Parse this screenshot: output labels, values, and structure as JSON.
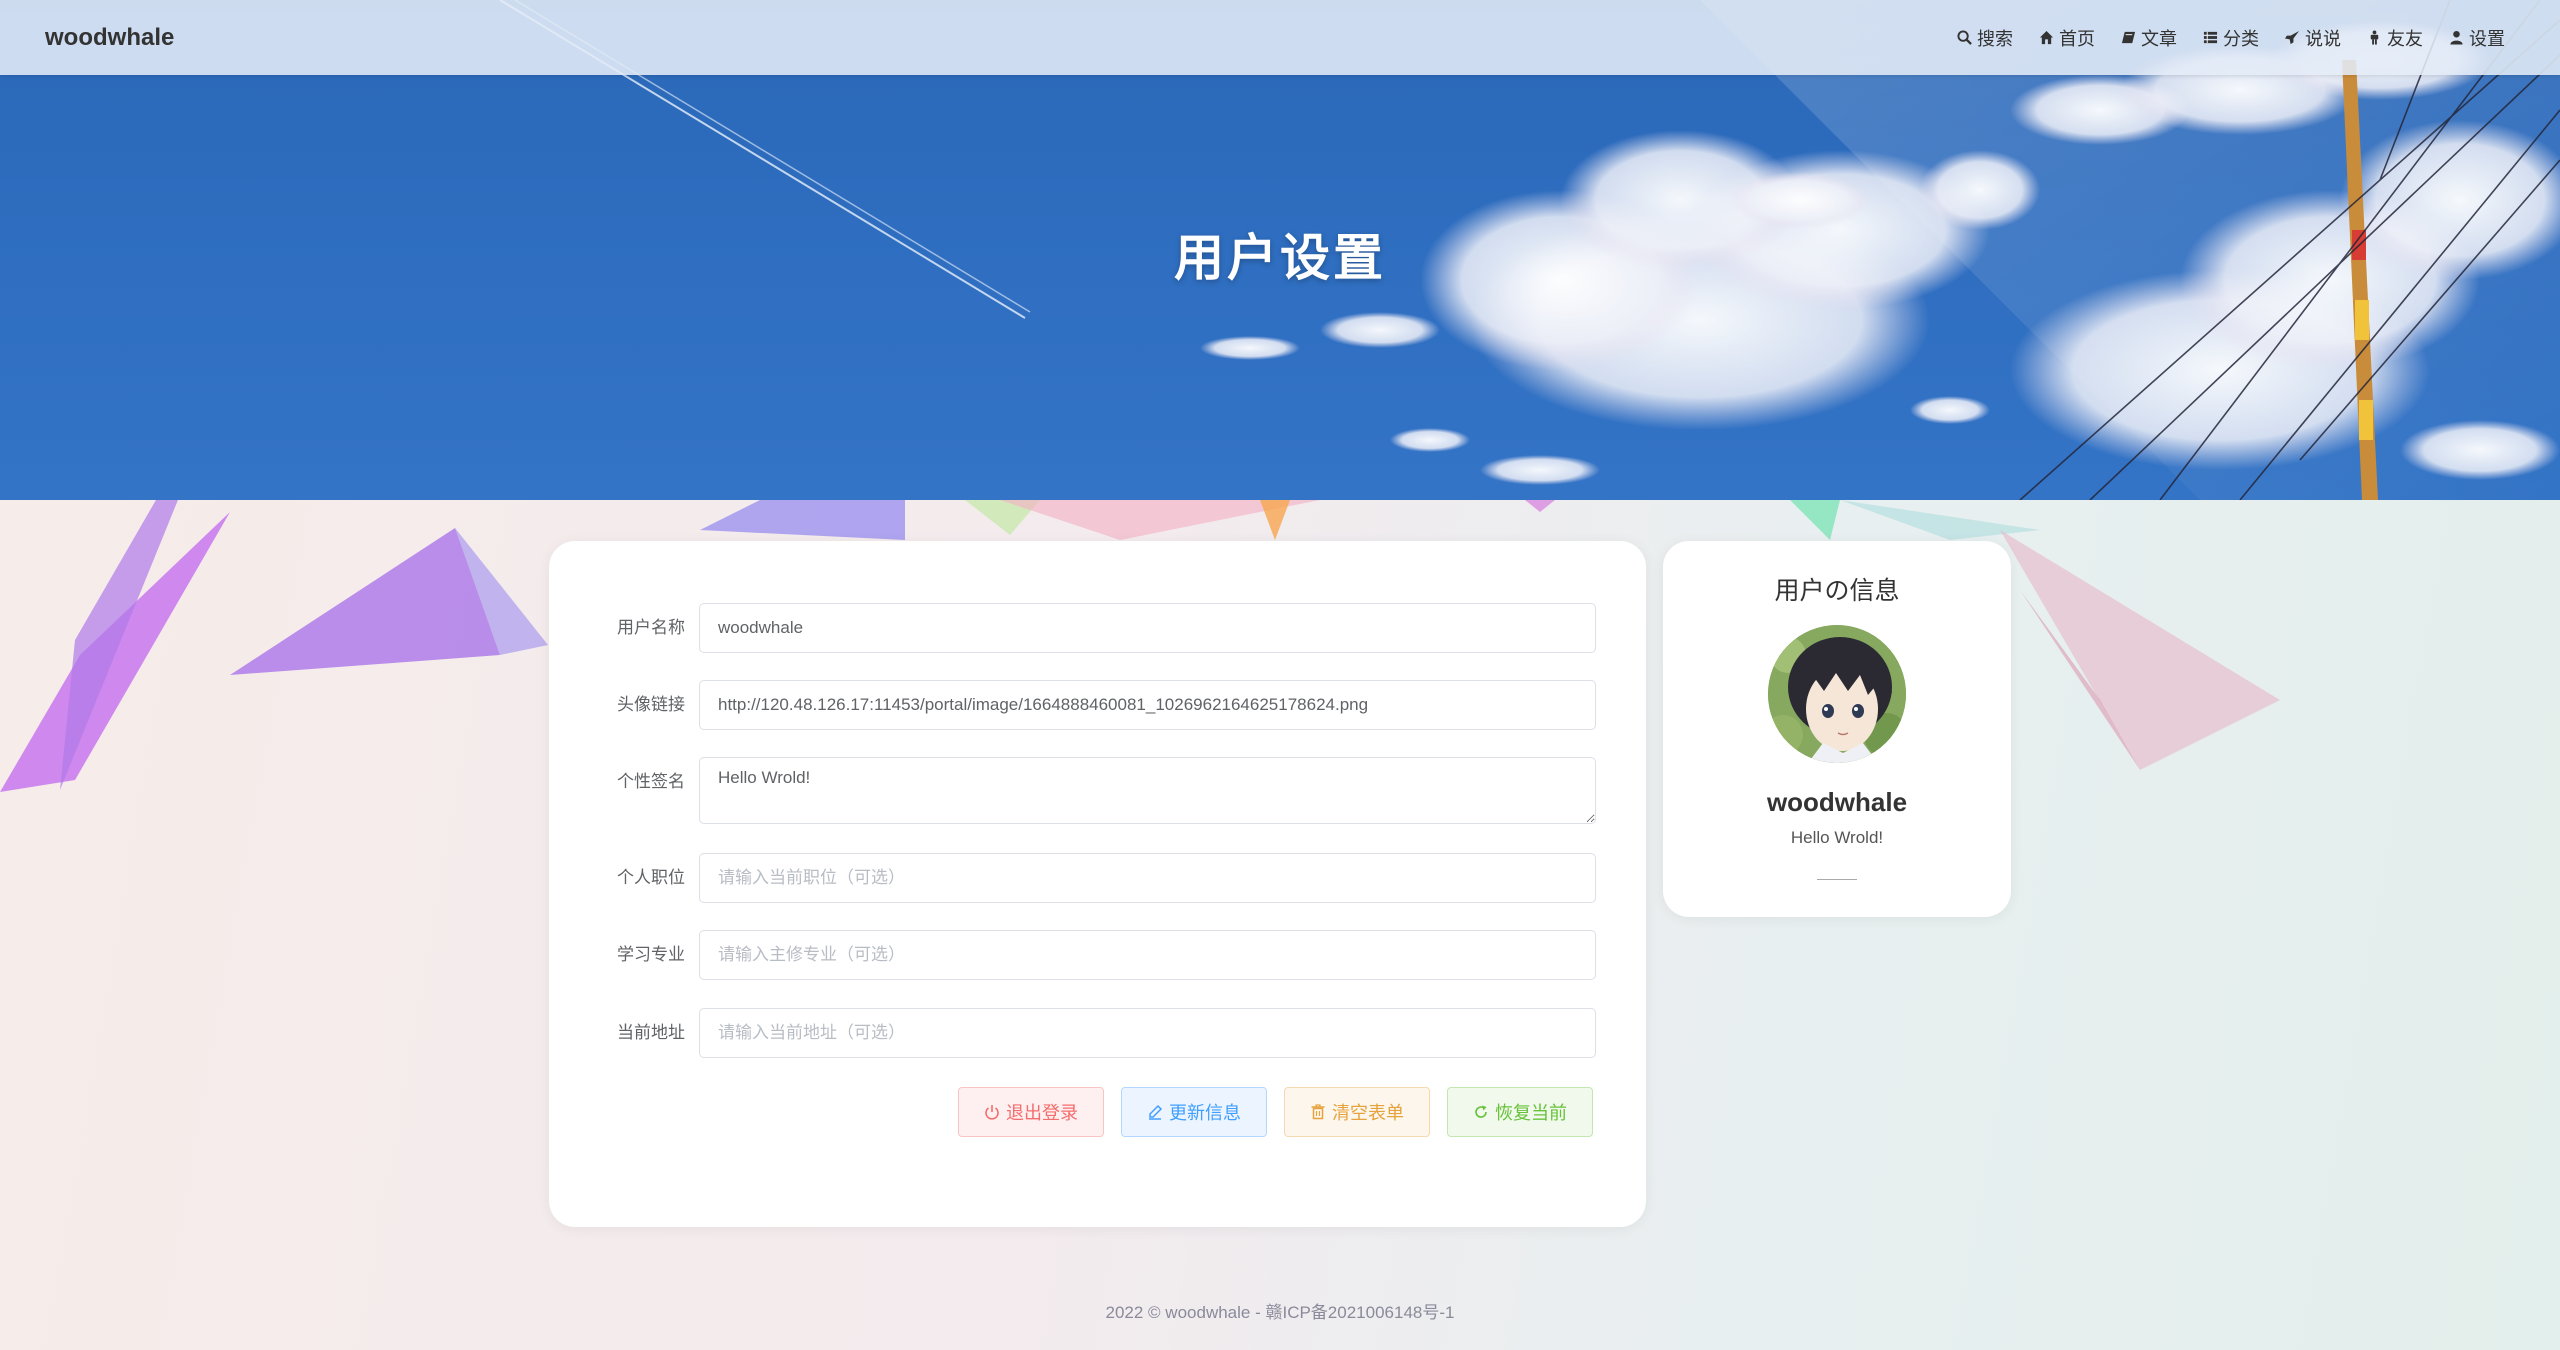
{
  "navbar": {
    "brand": "woodwhale",
    "items": [
      {
        "label": "搜索",
        "icon": "search-icon"
      },
      {
        "label": "首页",
        "icon": "home-icon"
      },
      {
        "label": "文章",
        "icon": "book-icon"
      },
      {
        "label": "分类",
        "icon": "list-icon"
      },
      {
        "label": "说说",
        "icon": "rocket-icon"
      },
      {
        "label": "友友",
        "icon": "person-icon"
      },
      {
        "label": "设置",
        "icon": "user-icon"
      }
    ]
  },
  "hero": {
    "title": "用户设置"
  },
  "form": {
    "username": {
      "label": "用户名称",
      "value": "woodwhale"
    },
    "avatar_url": {
      "label": "头像链接",
      "value": "http://120.48.126.17:11453/portal/image/1664888460081_1026962164625178624.png"
    },
    "signature": {
      "label": "个性签名",
      "value": "Hello Wrold!"
    },
    "position": {
      "label": "个人职位",
      "placeholder": "请输入当前职位（可选）"
    },
    "major": {
      "label": "学习专业",
      "placeholder": "请输入主修专业（可选）"
    },
    "address": {
      "label": "当前地址",
      "placeholder": "请输入当前地址（可选）"
    },
    "buttons": {
      "logout": "退出登录",
      "update": "更新信息",
      "clear": "清空表单",
      "restore": "恢复当前"
    }
  },
  "profile": {
    "heading": "用户の信息",
    "name": "woodwhale",
    "signature": "Hello Wrold!"
  },
  "footer": {
    "text": "2022 © woodwhale - 赣ICP备2021006148号-1"
  },
  "colors": {
    "danger": "#f56c6c",
    "primary": "#409eff",
    "warning": "#e6a23c",
    "success": "#67c23a"
  }
}
